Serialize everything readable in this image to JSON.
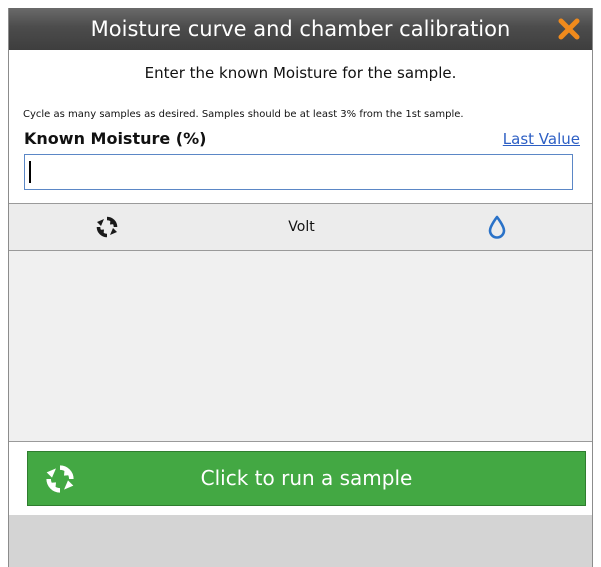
{
  "dialog": {
    "title": "Moisture curve and chamber calibration",
    "close_icon": "close-icon"
  },
  "instruction": "Enter the known Moisture for the sample.",
  "hint": "Cycle as many samples as desired. Samples should be at least 3% from the 1st sample.",
  "field": {
    "label": "Known Moisture (%)",
    "last_value_link": "Last Value",
    "value": "",
    "placeholder": ""
  },
  "table": {
    "columns": [
      {
        "icon": "cycle-icon",
        "label": ""
      },
      {
        "icon": "",
        "label": "Volt"
      },
      {
        "icon": "water-drop-icon",
        "label": ""
      }
    ],
    "rows": []
  },
  "run_button": {
    "icon": "cycle-icon",
    "label": "Click to run a sample"
  },
  "colors": {
    "accent_green": "#43a843",
    "close_orange": "#f08a1c",
    "drop_blue": "#2a72c8",
    "link_blue": "#2d5fc4"
  }
}
